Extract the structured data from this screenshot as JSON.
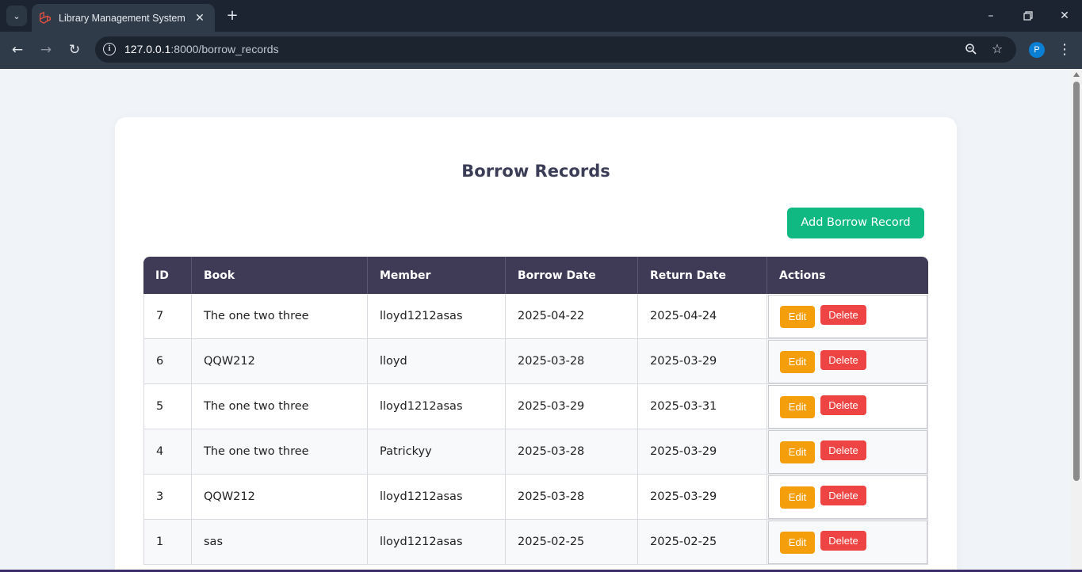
{
  "browser": {
    "tab_title": "Library Management System",
    "tab_close": "✕",
    "new_tab": "+",
    "url_host": "127.0.0.1",
    "url_path": ":8000/borrow_records",
    "profile_initial": "P"
  },
  "page": {
    "title": "Borrow Records",
    "add_button": "Add Borrow Record"
  },
  "table": {
    "headers": [
      "ID",
      "Book",
      "Member",
      "Borrow Date",
      "Return Date",
      "Actions"
    ],
    "rows": [
      {
        "id": "7",
        "book": "The one two three",
        "member": "lloyd1212asas",
        "borrow_date": "2025-04-22",
        "return_date": "2025-04-24"
      },
      {
        "id": "6",
        "book": "QQW212",
        "member": "lloyd",
        "borrow_date": "2025-03-28",
        "return_date": "2025-03-29"
      },
      {
        "id": "5",
        "book": "The one two three",
        "member": "lloyd1212asas",
        "borrow_date": "2025-03-29",
        "return_date": "2025-03-31"
      },
      {
        "id": "4",
        "book": "The one two three",
        "member": "Patrickyy",
        "borrow_date": "2025-03-28",
        "return_date": "2025-03-29"
      },
      {
        "id": "3",
        "book": "QQW212",
        "member": "lloyd1212asas",
        "borrow_date": "2025-03-28",
        "return_date": "2025-03-29"
      },
      {
        "id": "1",
        "book": "sas",
        "member": "lloyd1212asas",
        "borrow_date": "2025-02-25",
        "return_date": "2025-02-25"
      }
    ],
    "edit_label": "Edit",
    "delete_label": "Delete"
  },
  "colors": {
    "header_bg": "#3f3a55",
    "add_button": "#10b981",
    "edit_button": "#f59e0b",
    "delete_button": "#ef4444"
  }
}
